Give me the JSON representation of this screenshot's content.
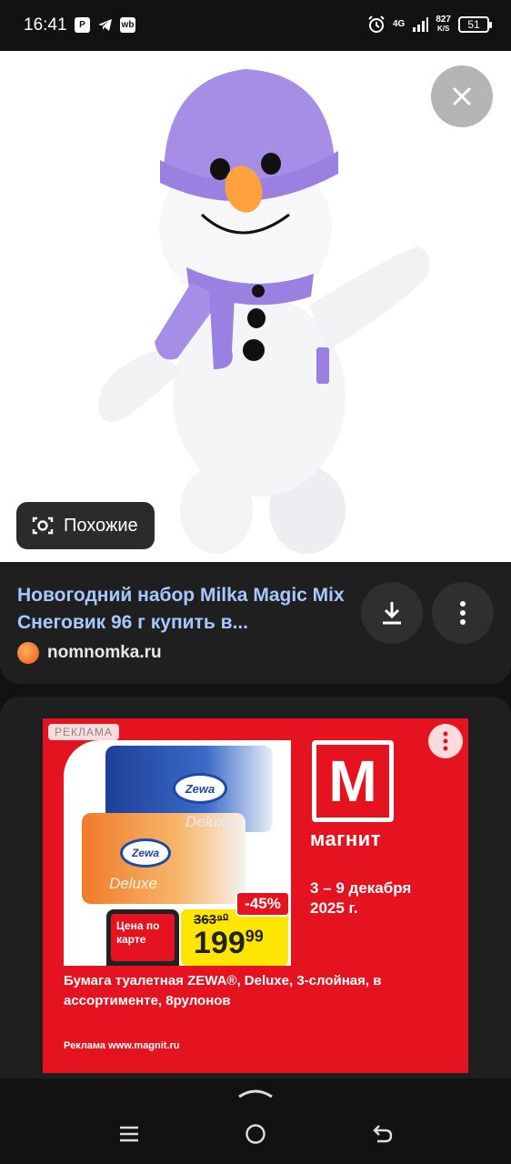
{
  "status_bar": {
    "time": "16:41",
    "left_icons": [
      "bluetooth-p-icon",
      "telegram-icon",
      "wb-icon"
    ],
    "network": "4G",
    "speed_value": "827",
    "speed_unit": "K/S",
    "battery": "51"
  },
  "viewer": {
    "image_subject": "plush snowman toy with purple hat and scarf",
    "similar_button": "Похожие"
  },
  "result": {
    "title": "Новогодний набор Milka Magic Mix Снеговик 96 г купить в...",
    "source": "nomnomka.ru"
  },
  "ad": {
    "label": "РЕКЛАМА",
    "brand": "магнит",
    "dates": "3 – 9 декабря 2025 г.",
    "old_price": "363⁹⁰",
    "new_price": "199",
    "new_price_cents": "99",
    "discount": "-45%",
    "card_price_label": "Цена по карте",
    "product_description": "Бумага туалетная ZEWA®, Deluxe, 3-слойная, в ассортименте, 8рулонов",
    "footer": "Реклама www.magnit.ru",
    "pack_brand": "Zewa",
    "pack_line": "Deluxe"
  },
  "colors": {
    "link": "#a6c8ff",
    "magnit_red": "#e5121f",
    "price_yellow": "#ffe600"
  }
}
